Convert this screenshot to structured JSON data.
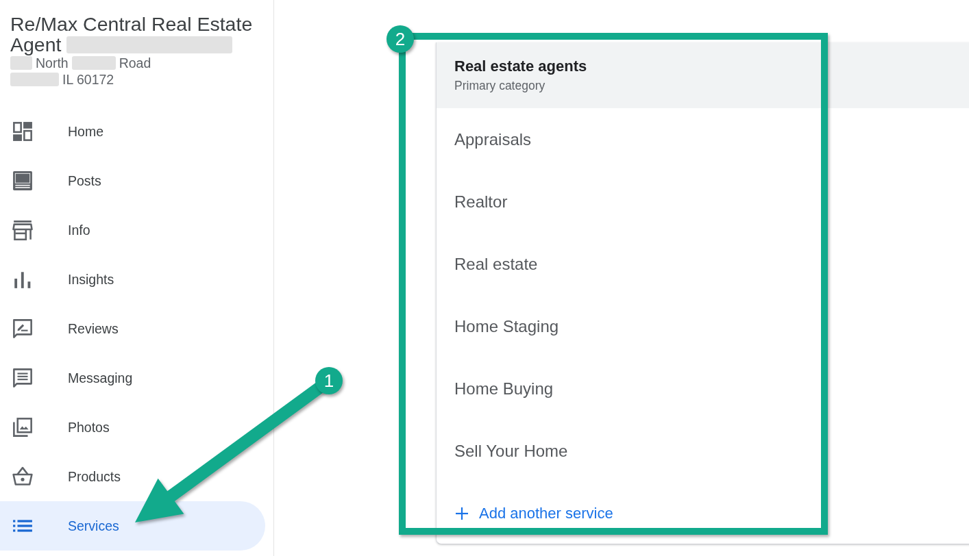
{
  "business": {
    "name_lines": [
      {
        "parts": [
          {
            "kind": "text",
            "text": "Re/Max Central Real Estate"
          }
        ]
      },
      {
        "parts": [
          {
            "kind": "text",
            "text": "Agent"
          },
          {
            "kind": "redacted"
          }
        ]
      }
    ],
    "address_lines": [
      {
        "parts": [
          {
            "kind": "redacted"
          },
          {
            "kind": "text",
            "text": "North"
          },
          {
            "kind": "redacted"
          },
          {
            "kind": "text",
            "text": "Road"
          }
        ]
      },
      {
        "parts": [
          {
            "kind": "redacted"
          },
          {
            "kind": "text",
            "text": "IL 60172"
          }
        ]
      }
    ]
  },
  "nav": [
    {
      "label": "Home",
      "selected": false
    },
    {
      "label": "Posts",
      "selected": false
    },
    {
      "label": "Info",
      "selected": false
    },
    {
      "label": "Insights",
      "selected": false
    },
    {
      "label": "Reviews",
      "selected": false
    },
    {
      "label": "Messaging",
      "selected": false
    },
    {
      "label": "Photos",
      "selected": false
    },
    {
      "label": "Products",
      "selected": false
    },
    {
      "label": "Services",
      "selected": true
    }
  ],
  "primary_category": {
    "title": "Real estate agents",
    "subtitle": "Primary category"
  },
  "services": [
    "Appraisals",
    "Realtor",
    "Real estate",
    "Home Staging",
    "Home Buying",
    "Sell Your Home"
  ],
  "add_button": {
    "label": "Add another service"
  },
  "callouts": [
    {
      "kind": "arrow",
      "number": "1"
    },
    {
      "kind": "frame",
      "number": "2"
    }
  ]
}
